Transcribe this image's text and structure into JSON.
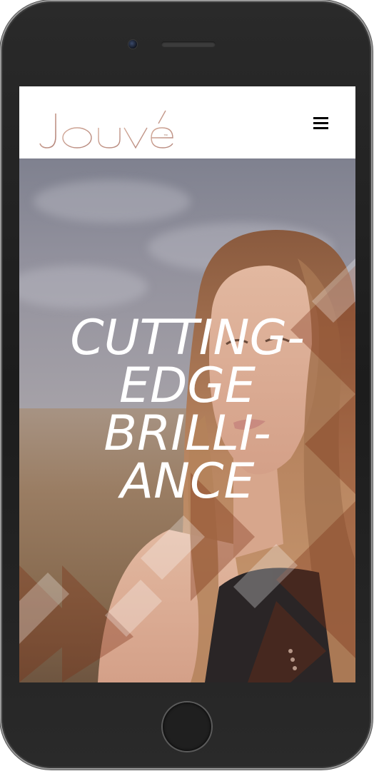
{
  "header": {
    "logo_text": "JOUVé",
    "trademark": "™",
    "menu_icon": "hamburger-menu-icon"
  },
  "hero": {
    "headline_lines": [
      "CUTTING-",
      "EDGE",
      "BRILLI-",
      "ANCE"
    ]
  },
  "device": {
    "home_icon": "home-button-icon"
  },
  "colors": {
    "brand": "#c49a8a",
    "header_bg": "#ffffff",
    "headline": "#ffffff"
  }
}
